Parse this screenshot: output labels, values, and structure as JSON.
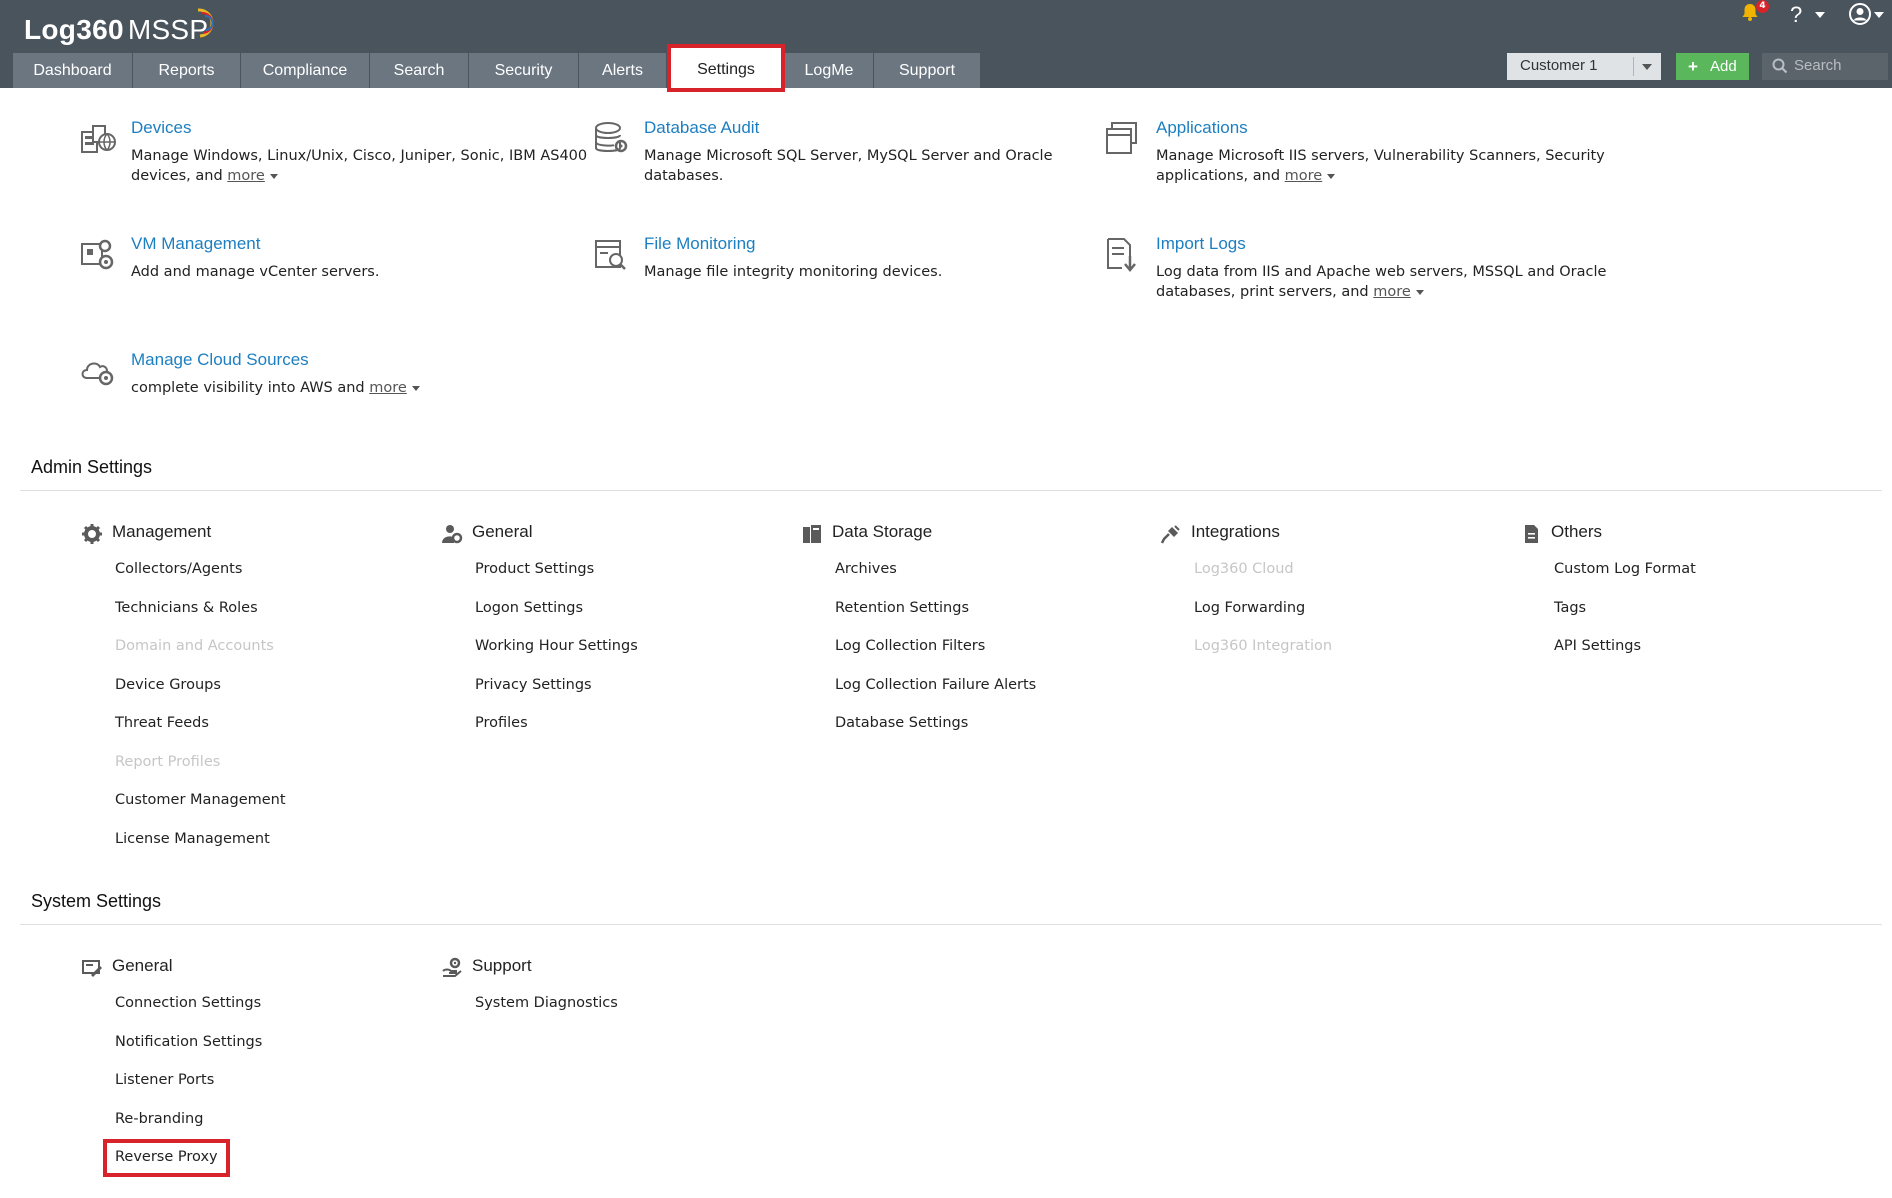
{
  "app": {
    "brand": "Log360",
    "brand_suffix": "MSSP"
  },
  "header": {
    "tabs": [
      {
        "label": "Dashboard",
        "active": false
      },
      {
        "label": "Reports",
        "active": false
      },
      {
        "label": "Compliance",
        "active": false
      },
      {
        "label": "Search",
        "active": false
      },
      {
        "label": "Security",
        "active": false
      },
      {
        "label": "Alerts",
        "active": false
      },
      {
        "label": "Settings",
        "active": true
      },
      {
        "label": "LogMe",
        "active": false
      },
      {
        "label": "Support",
        "active": false
      }
    ],
    "customer_select": "Customer 1",
    "add_label": "Add",
    "search_placeholder": "Search",
    "notification_count": "4",
    "help_label": "?"
  },
  "cards": [
    {
      "title": "Devices",
      "desc": "Manage Windows, Linux/Unix, Cisco, Juniper, Sonic, IBM AS400 devices, and",
      "more": "more",
      "icon": "devices-icon"
    },
    {
      "title": "Database Audit",
      "desc": "Manage Microsoft SQL Server, MySQL Server and Oracle databases.",
      "more": "",
      "icon": "database-icon"
    },
    {
      "title": "Applications",
      "desc": "Manage Microsoft IIS servers, Vulnerability Scanners, Security applications, and",
      "more": "more",
      "icon": "applications-icon"
    },
    {
      "title": "VM Management",
      "desc": "Add and manage vCenter servers.",
      "more": "",
      "icon": "vm-icon"
    },
    {
      "title": "File Monitoring",
      "desc": "Manage file integrity monitoring devices.",
      "more": "",
      "icon": "file-monitoring-icon"
    },
    {
      "title": "Import Logs",
      "desc": "Log data from IIS and Apache web servers, MSSQL and Oracle databases, print servers, and",
      "more": "more",
      "icon": "import-logs-icon"
    },
    {
      "title": "Manage Cloud Sources",
      "desc": "complete visibility into AWS and",
      "more": "more",
      "icon": "cloud-gear-icon"
    }
  ],
  "admin_settings": {
    "title": "Admin Settings",
    "columns": [
      {
        "heading": "Management",
        "icon": "gear-icon",
        "items": [
          {
            "label": "Collectors/Agents",
            "disabled": false
          },
          {
            "label": "Technicians & Roles",
            "disabled": false
          },
          {
            "label": "Domain and Accounts",
            "disabled": true
          },
          {
            "label": "Device Groups",
            "disabled": false
          },
          {
            "label": "Threat Feeds",
            "disabled": false
          },
          {
            "label": "Report Profiles",
            "disabled": true
          },
          {
            "label": "Customer Management",
            "disabled": false
          },
          {
            "label": "License Management",
            "disabled": false
          }
        ]
      },
      {
        "heading": "General",
        "icon": "user-gear-icon",
        "items": [
          {
            "label": "Product Settings",
            "disabled": false
          },
          {
            "label": "Logon Settings",
            "disabled": false
          },
          {
            "label": "Working Hour Settings",
            "disabled": false
          },
          {
            "label": "Privacy Settings",
            "disabled": false
          },
          {
            "label": "Profiles",
            "disabled": false
          }
        ]
      },
      {
        "heading": "Data Storage",
        "icon": "storage-icon",
        "items": [
          {
            "label": "Archives",
            "disabled": false
          },
          {
            "label": "Retention Settings",
            "disabled": false
          },
          {
            "label": "Log Collection Filters",
            "disabled": false
          },
          {
            "label": "Log Collection Failure Alerts",
            "disabled": false
          },
          {
            "label": "Database Settings",
            "disabled": false
          }
        ]
      },
      {
        "heading": "Integrations",
        "icon": "plug-icon",
        "items": [
          {
            "label": "Log360 Cloud",
            "disabled": true
          },
          {
            "label": "Log Forwarding",
            "disabled": false
          },
          {
            "label": "Log360 Integration",
            "disabled": true
          }
        ]
      },
      {
        "heading": "Others",
        "icon": "document-icon",
        "items": [
          {
            "label": "Custom Log Format",
            "disabled": false
          },
          {
            "label": "Tags",
            "disabled": false
          },
          {
            "label": "API Settings",
            "disabled": false
          }
        ]
      }
    ]
  },
  "system_settings": {
    "title": "System Settings",
    "columns": [
      {
        "heading": "General",
        "icon": "settings-pen-icon",
        "items": [
          {
            "label": "Connection Settings",
            "disabled": false
          },
          {
            "label": "Notification Settings",
            "disabled": false
          },
          {
            "label": "Listener Ports",
            "disabled": false
          },
          {
            "label": "Re-branding",
            "disabled": false
          },
          {
            "label": "Reverse Proxy",
            "disabled": false,
            "highlighted": true
          }
        ]
      },
      {
        "heading": "Support",
        "icon": "support-gear-icon",
        "items": [
          {
            "label": "System Diagnostics",
            "disabled": false
          }
        ]
      }
    ]
  },
  "colors": {
    "header_bg": "#4a545c",
    "tab_bg": "#6b7680",
    "link": "#1c7fc1",
    "highlight": "#d9232a",
    "add_button": "#5bb75b"
  }
}
